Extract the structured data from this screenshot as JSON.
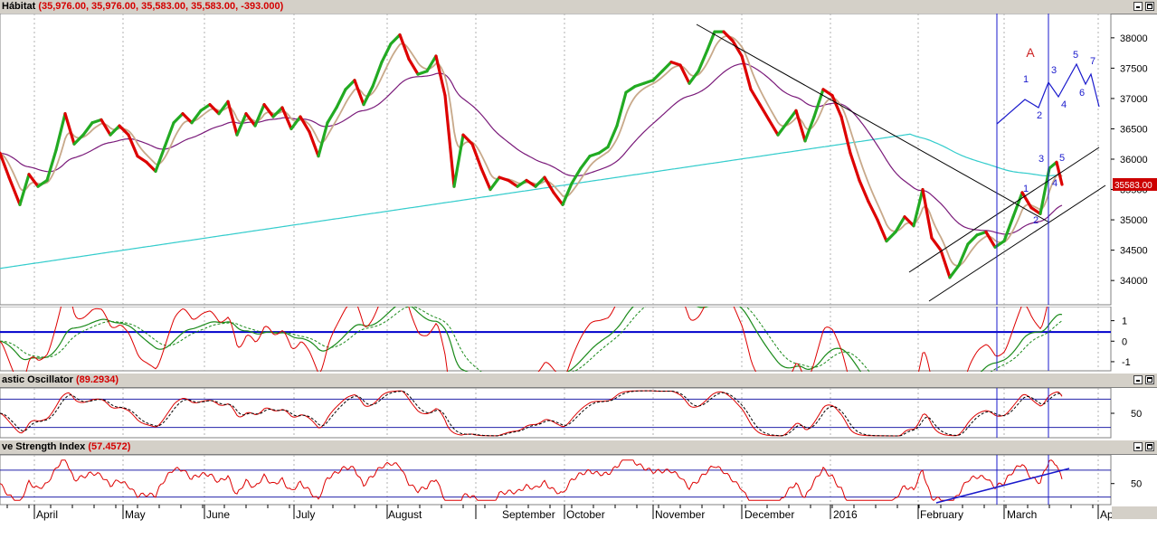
{
  "panels": {
    "main": {
      "name": "Hábitat",
      "values": "(35,976.00, 35,976.00, 35,583.00, 35,583.00, -393.000)"
    },
    "stoch": {
      "name": "astic Oscillator",
      "values": "(89.2934)"
    },
    "rsi": {
      "name": "ve Strength Index",
      "values": "(57.4572)"
    }
  },
  "colors": {
    "up": "#22aa22",
    "down": "#dd0000",
    "ma_fast": "#c8a98a",
    "ma_mid": "#7a1a7a",
    "ma_slow": "#33cccc",
    "annot": "#1a1acc",
    "annot_red": "#cc2222",
    "grid": "#b0b0b0"
  },
  "chart_data": [
    {
      "type": "line",
      "panel": "price",
      "yticks": [
        34000,
        34500,
        35000,
        35500,
        36000,
        36500,
        37000,
        37500,
        38000
      ],
      "ylim": [
        33600,
        38400
      ],
      "last_price_label": "35583.00",
      "x_months": [
        "April",
        "May",
        "June",
        "July",
        "August",
        "September",
        "October",
        "November",
        "December",
        "2016",
        "February",
        "March",
        "Ap"
      ],
      "price_path": [
        [
          0,
          36100
        ],
        [
          10,
          35700
        ],
        [
          22,
          35250
        ],
        [
          32,
          35750
        ],
        [
          42,
          35550
        ],
        [
          52,
          35650
        ],
        [
          62,
          36150
        ],
        [
          72,
          36750
        ],
        [
          82,
          36250
        ],
        [
          92,
          36400
        ],
        [
          102,
          36600
        ],
        [
          112,
          36650
        ],
        [
          122,
          36400
        ],
        [
          132,
          36550
        ],
        [
          142,
          36400
        ],
        [
          152,
          36050
        ],
        [
          162,
          35950
        ],
        [
          172,
          35800
        ],
        [
          182,
          36200
        ],
        [
          192,
          36600
        ],
        [
          202,
          36750
        ],
        [
          212,
          36600
        ],
        [
          222,
          36800
        ],
        [
          232,
          36900
        ],
        [
          242,
          36750
        ],
        [
          252,
          36950
        ],
        [
          262,
          36400
        ],
        [
          272,
          36750
        ],
        [
          282,
          36550
        ],
        [
          292,
          36900
        ],
        [
          302,
          36700
        ],
        [
          312,
          36850
        ],
        [
          322,
          36500
        ],
        [
          332,
          36700
        ],
        [
          342,
          36450
        ],
        [
          352,
          36050
        ],
        [
          362,
          36600
        ],
        [
          372,
          36850
        ],
        [
          382,
          37150
        ],
        [
          392,
          37300
        ],
        [
          402,
          36900
        ],
        [
          412,
          37200
        ],
        [
          422,
          37600
        ],
        [
          432,
          37900
        ],
        [
          442,
          38050
        ],
        [
          452,
          37650
        ],
        [
          462,
          37400
        ],
        [
          472,
          37450
        ],
        [
          482,
          37700
        ],
        [
          492,
          37050
        ],
        [
          502,
          35550
        ],
        [
          512,
          36400
        ],
        [
          522,
          36250
        ],
        [
          532,
          35850
        ],
        [
          542,
          35500
        ],
        [
          552,
          35700
        ],
        [
          562,
          35650
        ],
        [
          572,
          35550
        ],
        [
          582,
          35650
        ],
        [
          592,
          35550
        ],
        [
          602,
          35700
        ],
        [
          612,
          35450
        ],
        [
          622,
          35250
        ],
        [
          632,
          35600
        ],
        [
          642,
          35850
        ],
        [
          652,
          36050
        ],
        [
          662,
          36100
        ],
        [
          672,
          36200
        ],
        [
          682,
          36550
        ],
        [
          692,
          37100
        ],
        [
          702,
          37200
        ],
        [
          712,
          37250
        ],
        [
          722,
          37300
        ],
        [
          732,
          37450
        ],
        [
          742,
          37600
        ],
        [
          752,
          37550
        ],
        [
          762,
          37250
        ],
        [
          772,
          37450
        ],
        [
          782,
          37800
        ],
        [
          790,
          38100
        ],
        [
          800,
          38100
        ],
        [
          810,
          37950
        ],
        [
          820,
          37700
        ],
        [
          830,
          37150
        ],
        [
          840,
          36900
        ],
        [
          850,
          36650
        ],
        [
          860,
          36400
        ],
        [
          870,
          36600
        ],
        [
          880,
          36800
        ],
        [
          890,
          36300
        ],
        [
          900,
          36700
        ],
        [
          910,
          37150
        ],
        [
          920,
          37050
        ],
        [
          930,
          36700
        ],
        [
          940,
          36100
        ],
        [
          950,
          35650
        ],
        [
          960,
          35300
        ],
        [
          970,
          35000
        ],
        [
          980,
          34650
        ],
        [
          990,
          34800
        ],
        [
          1000,
          35050
        ],
        [
          1010,
          34900
        ],
        [
          1020,
          35500
        ],
        [
          1030,
          34700
        ],
        [
          1040,
          34500
        ],
        [
          1050,
          34050
        ],
        [
          1060,
          34250
        ],
        [
          1070,
          34600
        ],
        [
          1080,
          34750
        ],
        [
          1090,
          34800
        ],
        [
          1100,
          34550
        ],
        [
          1110,
          34650
        ],
        [
          1120,
          35050
        ],
        [
          1130,
          35450
        ],
        [
          1140,
          35200
        ],
        [
          1150,
          35100
        ],
        [
          1160,
          35850
        ],
        [
          1168,
          35950
        ],
        [
          1174,
          35583
        ]
      ],
      "annotations": {
        "big_wave_labels": [
          "A",
          "1",
          "2",
          "3",
          "4",
          "5",
          "6",
          "7"
        ],
        "small_wave_labels": [
          "1",
          "2",
          "3",
          "4",
          "5"
        ]
      }
    },
    {
      "type": "line",
      "panel": "macd",
      "yticks": [
        1,
        0,
        -1
      ],
      "ylim": [
        -1.4,
        1.6
      ]
    },
    {
      "type": "line",
      "panel": "stochastic",
      "yticks": [
        50
      ],
      "ylim": [
        0,
        100
      ],
      "last_value": 89.2934
    },
    {
      "type": "line",
      "panel": "rsi",
      "yticks": [
        50
      ],
      "ylim": [
        20,
        90
      ],
      "last_value": 57.4572
    }
  ]
}
